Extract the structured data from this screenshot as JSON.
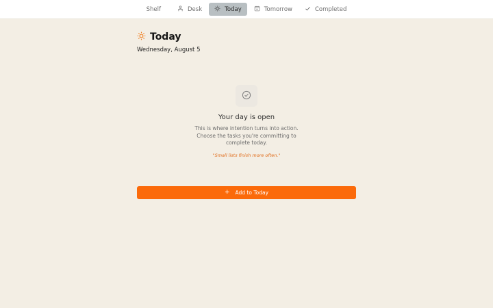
{
  "nav": {
    "tabs": [
      {
        "label": "Shelf",
        "icon": "none",
        "active": false
      },
      {
        "label": "Desk",
        "icon": "desk-icon",
        "active": false
      },
      {
        "label": "Today",
        "icon": "sun-icon",
        "active": true
      },
      {
        "label": "Tomorrow",
        "icon": "calendar-icon",
        "active": false
      },
      {
        "label": "Completed",
        "icon": "check-icon",
        "active": false
      }
    ]
  },
  "page": {
    "title": "Today",
    "title_icon": "sun-icon",
    "date": "Wednesday, August 5"
  },
  "empty_state": {
    "icon": "check-circle-icon",
    "title": "Your day is open",
    "body": "This is where intention turns into action. Choose the tasks you're committing to complete today.",
    "quote": "\"Small lists finish more often.\""
  },
  "actions": {
    "add_label": "Add to Today",
    "add_icon": "plus-icon"
  },
  "colors": {
    "background": "#f3eee4",
    "accent": "#fb6a0a",
    "active_tab": "#b8bfc2"
  }
}
